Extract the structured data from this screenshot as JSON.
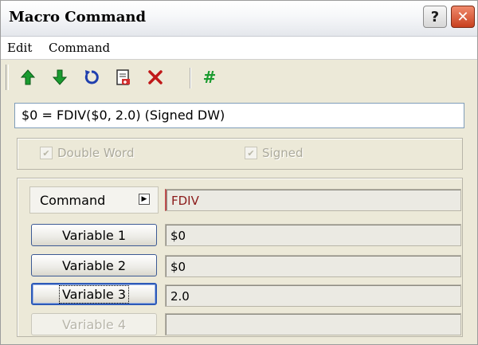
{
  "window": {
    "title": "Macro Command"
  },
  "titlebar": {
    "help_label": "?",
    "close_label": "✕"
  },
  "menu": [
    {
      "label": "Edit"
    },
    {
      "label": "Command"
    }
  ],
  "toolbar": {
    "tools": [
      {
        "icon": "arrow-up-icon",
        "color": "#1a9b2f"
      },
      {
        "icon": "arrow-down-icon",
        "color": "#1a9b2f"
      },
      {
        "icon": "rotate-icon",
        "color": "#1f3fae"
      },
      {
        "icon": "document-icon",
        "color": "#b32020"
      },
      {
        "icon": "delete-icon",
        "color": "#c01818"
      },
      {
        "icon": "hash-icon",
        "color": "#1a9b2f"
      }
    ],
    "hash_label": "#"
  },
  "expression": {
    "value": "$0 = FDIV($0, 2.0) (Signed DW)"
  },
  "options": {
    "double_word": {
      "label": "Double Word",
      "checked": true,
      "enabled": false
    },
    "signed": {
      "label": "Signed",
      "checked": true,
      "enabled": false
    }
  },
  "command": {
    "label": "Command",
    "value": "FDIV"
  },
  "variables": [
    {
      "label": "Variable 1",
      "value": "$0",
      "enabled": true
    },
    {
      "label": "Variable 2",
      "value": "$0",
      "enabled": true
    },
    {
      "label": "Variable 3",
      "value": "2.0",
      "enabled": true,
      "focused": true
    },
    {
      "label": "Variable 4",
      "value": "",
      "enabled": false
    }
  ]
}
